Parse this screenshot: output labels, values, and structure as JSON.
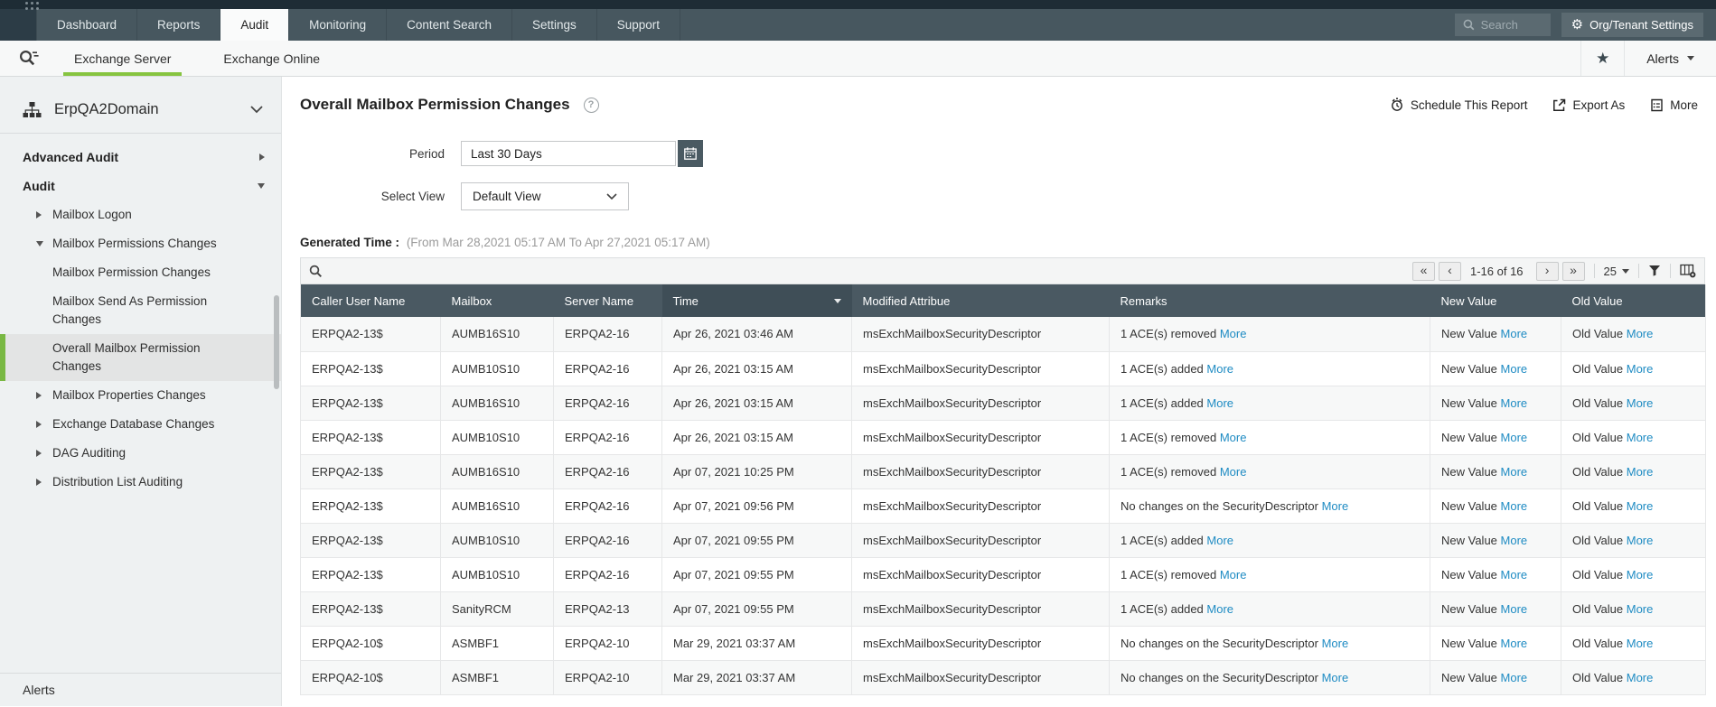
{
  "topbar": {
    "tabs": [
      "Dashboard",
      "Reports",
      "Audit",
      "Monitoring",
      "Content Search",
      "Settings",
      "Support"
    ],
    "active_tab": "Audit",
    "search_placeholder": "Search",
    "org_settings_label": "Org/Tenant Settings"
  },
  "subnav": {
    "tabs": [
      "Exchange Server",
      "Exchange Online"
    ],
    "active_tab": "Exchange Server",
    "alerts_label": "Alerts"
  },
  "sidebar": {
    "domain": "ErpQA2Domain",
    "items": [
      {
        "label": "Advanced Audit",
        "level": 0,
        "arrow": "right"
      },
      {
        "label": "Audit",
        "level": 0,
        "arrow": "down"
      },
      {
        "label": "Mailbox Logon",
        "level": 1,
        "arrow": "right"
      },
      {
        "label": "Mailbox Permissions Changes",
        "level": 1,
        "arrow": "down"
      },
      {
        "label": "Mailbox Permission Changes",
        "level": 2
      },
      {
        "label": "Mailbox Send As Permission Changes",
        "level": 2
      },
      {
        "label": "Overall Mailbox Permission Changes",
        "level": 2,
        "selected": true
      },
      {
        "label": "Mailbox Properties Changes",
        "level": 1,
        "arrow": "right"
      },
      {
        "label": "Exchange Database Changes",
        "level": 1,
        "arrow": "right"
      },
      {
        "label": "DAG Auditing",
        "level": 1,
        "arrow": "right"
      },
      {
        "label": "Distribution List Auditing",
        "level": 1,
        "arrow": "right"
      }
    ],
    "footer_label": "Alerts"
  },
  "report": {
    "title": "Overall Mailbox Permission Changes",
    "actions": [
      {
        "label": "Schedule This Report",
        "icon": "alarm-clock-icon"
      },
      {
        "label": "Export As",
        "icon": "export-icon"
      },
      {
        "label": "More",
        "icon": "more-reports-icon"
      }
    ],
    "period_label": "Period",
    "period_value": "Last 30 Days",
    "select_view_label": "Select View",
    "select_view_value": "Default View",
    "generated_time_label": "Generated Time :",
    "generated_time_range": "(From Mar 28,2021 05:17 AM To Apr 27,2021 05:17 AM)"
  },
  "table": {
    "pagination": {
      "range": "1-16 of 16",
      "page_size": "25"
    },
    "more_label": "More",
    "new_value_label": "New Value",
    "old_value_label": "Old Value",
    "sorted_column": "Time",
    "columns": [
      "Caller User Name",
      "Mailbox",
      "Server Name",
      "Time",
      "Modified Attribue",
      "Remarks",
      "New Value",
      "Old Value"
    ],
    "rows": [
      {
        "caller": "ERPQA2-13$",
        "mailbox": "AUMB16S10",
        "server": "ERPQA2-16",
        "time": "Apr 26, 2021 03:46 AM",
        "attribute": "msExchMailboxSecurityDescriptor",
        "remarks": "1 ACE(s) removed"
      },
      {
        "caller": "ERPQA2-13$",
        "mailbox": "AUMB10S10",
        "server": "ERPQA2-16",
        "time": "Apr 26, 2021 03:15 AM",
        "attribute": "msExchMailboxSecurityDescriptor",
        "remarks": "1 ACE(s) added"
      },
      {
        "caller": "ERPQA2-13$",
        "mailbox": "AUMB16S10",
        "server": "ERPQA2-16",
        "time": "Apr 26, 2021 03:15 AM",
        "attribute": "msExchMailboxSecurityDescriptor",
        "remarks": "1 ACE(s) added"
      },
      {
        "caller": "ERPQA2-13$",
        "mailbox": "AUMB10S10",
        "server": "ERPQA2-16",
        "time": "Apr 26, 2021 03:15 AM",
        "attribute": "msExchMailboxSecurityDescriptor",
        "remarks": "1 ACE(s) removed"
      },
      {
        "caller": "ERPQA2-13$",
        "mailbox": "AUMB16S10",
        "server": "ERPQA2-16",
        "time": "Apr 07, 2021 10:25 PM",
        "attribute": "msExchMailboxSecurityDescriptor",
        "remarks": "1 ACE(s) removed"
      },
      {
        "caller": "ERPQA2-13$",
        "mailbox": "AUMB16S10",
        "server": "ERPQA2-16",
        "time": "Apr 07, 2021 09:56 PM",
        "attribute": "msExchMailboxSecurityDescriptor",
        "remarks": "No changes on the SecurityDescriptor"
      },
      {
        "caller": "ERPQA2-13$",
        "mailbox": "AUMB10S10",
        "server": "ERPQA2-16",
        "time": "Apr 07, 2021 09:55 PM",
        "attribute": "msExchMailboxSecurityDescriptor",
        "remarks": "1 ACE(s) added"
      },
      {
        "caller": "ERPQA2-13$",
        "mailbox": "AUMB10S10",
        "server": "ERPQA2-16",
        "time": "Apr 07, 2021 09:55 PM",
        "attribute": "msExchMailboxSecurityDescriptor",
        "remarks": "1 ACE(s) removed"
      },
      {
        "caller": "ERPQA2-13$",
        "mailbox": "SanityRCM",
        "server": "ERPQA2-13",
        "time": "Apr 07, 2021 09:55 PM",
        "attribute": "msExchMailboxSecurityDescriptor",
        "remarks": "1 ACE(s) added"
      },
      {
        "caller": "ERPQA2-10$",
        "mailbox": "ASMBF1",
        "server": "ERPQA2-10",
        "time": "Mar 29, 2021 03:37 AM",
        "attribute": "msExchMailboxSecurityDescriptor",
        "remarks": "No changes on the SecurityDescriptor"
      },
      {
        "caller": "ERPQA2-10$",
        "mailbox": "ASMBF1",
        "server": "ERPQA2-10",
        "time": "Mar 29, 2021 03:37 AM",
        "attribute": "msExchMailboxSecurityDescriptor",
        "remarks": "No changes on the SecurityDescriptor"
      }
    ]
  }
}
